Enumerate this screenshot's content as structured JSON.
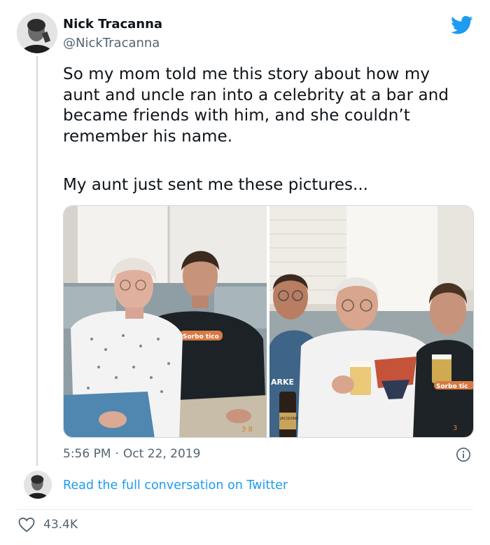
{
  "author": {
    "name": "Nick Tracanna",
    "handle": "@NickTracanna"
  },
  "icons": {
    "brand": "twitter-bird-icon",
    "info": "info-icon",
    "like": "heart-icon"
  },
  "colors": {
    "twitter_blue": "#1d9bf0",
    "secondary_text": "#536471"
  },
  "tweet": {
    "text": "So my mom told me this story about how my aunt and uncle ran into a celebrity at a bar and became friends with him, and she couldn’t remember his name.",
    "text2": "My aunt just sent me these pictures...",
    "time": "5:56 PM",
    "separator": "·",
    "date": "Oct 22, 2019"
  },
  "photos": {
    "left_shirt_logo": "Sorbo tico",
    "left_date_stamp": "3 8",
    "right_shirt_logo": "Sorbo tic",
    "right_date_stamp": "3",
    "beer_label": "JACQUINS ROCK",
    "shirt_text": "ARKE"
  },
  "footer": {
    "read_full": "Read the full conversation on Twitter",
    "likes": "43.4K"
  }
}
